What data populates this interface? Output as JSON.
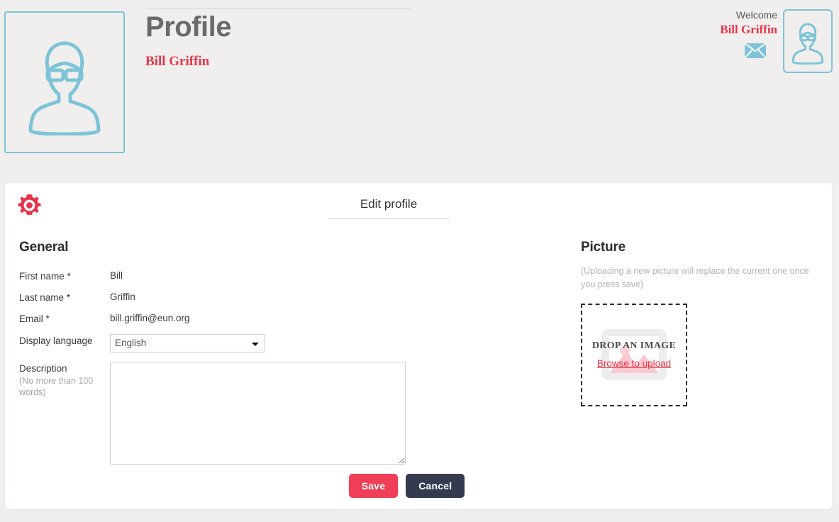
{
  "colors": {
    "page_background": "#f0efed",
    "accent_red": "#e8334a",
    "accent_blue": "#7dc4d8",
    "save_button": "#ef3e56",
    "cancel_button": "#343b4e",
    "card_background": "#ffffff"
  },
  "header": {
    "title": "Profile",
    "subtitle": "Bill Griffin",
    "avatar_icon": "user-avatar-icon",
    "welcome_label": "Welcome",
    "welcome_name": "Bill Griffin",
    "mail_icon": "envelope-icon",
    "mini_avatar_icon": "user-avatar-icon"
  },
  "card": {
    "gear_icon": "gear-icon",
    "tab": {
      "label": "Edit profile"
    },
    "general": {
      "heading": "General",
      "fields": [
        {
          "label": "First name *",
          "value": "Bill",
          "type": "text"
        },
        {
          "label": "Last name *",
          "value": "Griffin",
          "type": "text"
        },
        {
          "label": "Email *",
          "value": "bill.griffin@eun.org",
          "type": "text"
        }
      ],
      "language": {
        "label": "Display language",
        "selected": "English",
        "options": [
          "English"
        ]
      },
      "description": {
        "label": "Description",
        "hint": "(No more than 100 words)",
        "value": "",
        "placeholder": ""
      }
    },
    "picture": {
      "heading": "Picture",
      "note": "(Uploading a new picture will replace the current one once you press save)",
      "dropzone": {
        "text": "DROP AN IMAGE",
        "link": "Browse to upload",
        "placeholder_icon": "image-placeholder-icon"
      }
    },
    "actions": {
      "save_label": "Save",
      "cancel_label": "Cancel"
    }
  }
}
